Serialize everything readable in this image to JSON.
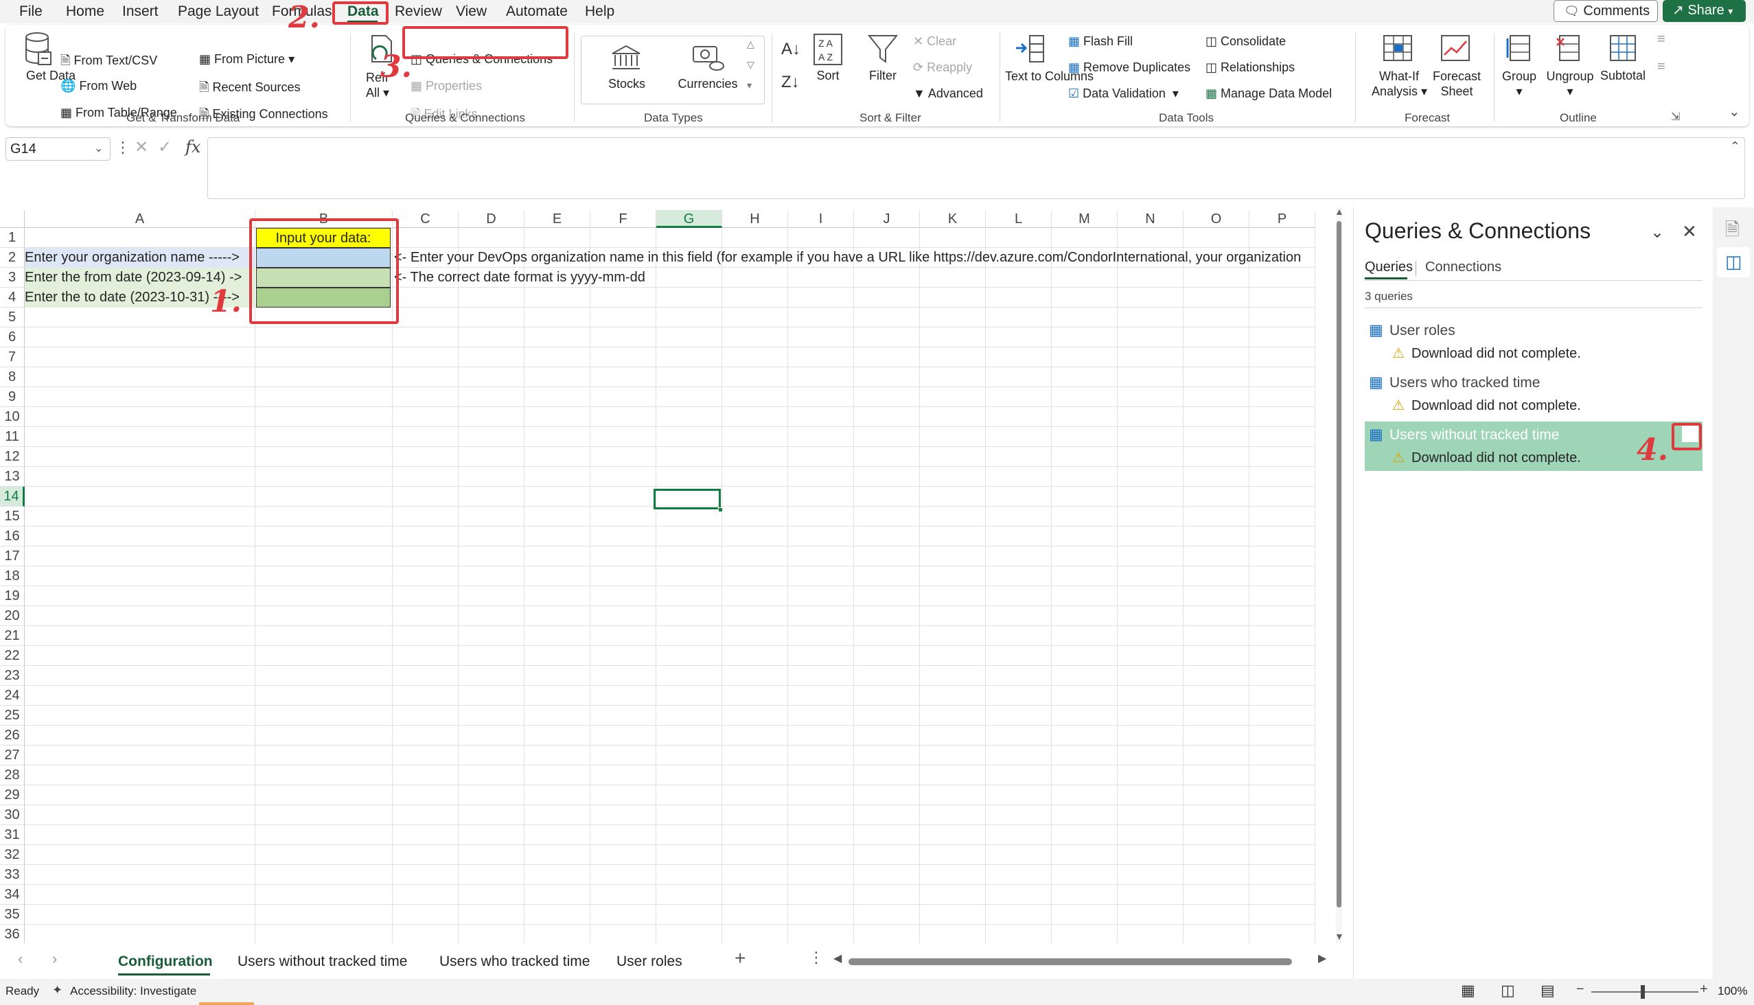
{
  "menu": {
    "tabs": [
      "File",
      "Home",
      "Insert",
      "Page Layout",
      "Formulas",
      "Data",
      "Review",
      "View",
      "Automate",
      "Help"
    ],
    "active": "Data",
    "comments_label": "Comments",
    "share_label": "Share"
  },
  "ribbon": {
    "get_transform": {
      "get_data": "Get Data",
      "from_text_csv": "From Text/CSV",
      "from_web": "From Web",
      "from_table_range": "From Table/Range",
      "from_picture": "From Picture",
      "recent_sources": "Recent Sources",
      "existing_connections": "Existing Connections",
      "label": "Get & Transform Data"
    },
    "queries": {
      "refresh_all": "Refresh All",
      "queries_connections": "Queries & Connections",
      "properties": "Properties",
      "edit_links": "Edit Links",
      "label": "Queries & Connections"
    },
    "data_types": {
      "stocks": "Stocks",
      "currencies": "Currencies",
      "label": "Data Types"
    },
    "sort_filter": {
      "sort": "Sort",
      "filter": "Filter",
      "clear": "Clear",
      "reapply": "Reapply",
      "advanced": "Advanced",
      "label": "Sort & Filter"
    },
    "data_tools": {
      "text_to_columns": "Text to Columns",
      "flash_fill": "Flash Fill",
      "remove_duplicates": "Remove Duplicates",
      "data_validation": "Data Validation",
      "consolidate": "Consolidate",
      "relationships": "Relationships",
      "manage_data_model": "Manage Data Model",
      "label": "Data Tools"
    },
    "forecast": {
      "what_if": "What-If Analysis",
      "forecast_sheet": "Forecast Sheet",
      "label": "Forecast"
    },
    "outline": {
      "group": "Group",
      "ungroup": "Ungroup",
      "subtotal": "Subtotal",
      "label": "Outline"
    }
  },
  "formula_bar": {
    "name_box": "G14",
    "fx": "fx"
  },
  "grid": {
    "columns": [
      "A",
      "B",
      "C",
      "D",
      "E",
      "F",
      "G",
      "H",
      "I",
      "J",
      "K",
      "L",
      "M",
      "N",
      "O",
      "P"
    ],
    "rows": [
      "1",
      "2",
      "3",
      "4",
      "5",
      "6",
      "7",
      "8",
      "9",
      "10",
      "11",
      "12",
      "13",
      "14",
      "15",
      "16",
      "17",
      "18",
      "19",
      "20",
      "21",
      "22",
      "23",
      "24",
      "25",
      "26",
      "27",
      "28",
      "29",
      "30",
      "31",
      "32",
      "33",
      "34",
      "35",
      "36"
    ],
    "b1": "Input your data:",
    "a2": "Enter your organization name ----->",
    "a3": "Enter the from date (2023-09-14) ->",
    "a4": "Enter the to date (2023-10-31) ---->",
    "c2": "<- Enter your DevOps organization name in this field (for example if you have a URL like https://dev.azure.com/CondorInternational, your organization",
    "c3": "<- The correct date format is yyyy-mm-dd",
    "colors": {
      "b1": "#ffff00",
      "b2": "#bdd7ee",
      "b3": "#c6e0b4",
      "b4": "#a9d08e",
      "a2": "#dde7f5",
      "a3": "#e2efda",
      "a4": "#e2efda"
    }
  },
  "sheets": {
    "tabs": [
      "Configuration",
      "Users without tracked time",
      "Users who tracked time",
      "User roles"
    ],
    "active": "Configuration"
  },
  "status": {
    "ready": "Ready",
    "accessibility": "Accessibility: Investigate",
    "zoom": "100%"
  },
  "pane": {
    "title": "Queries & Connections",
    "tab_queries": "Queries",
    "tab_connections": "Connections",
    "count": "3 queries",
    "items": [
      {
        "name": "User roles",
        "status": "Download did not complete."
      },
      {
        "name": "Users who tracked time",
        "status": "Download did not complete."
      },
      {
        "name": "Users without tracked time",
        "status": "Download did not complete."
      }
    ],
    "selected_color": "#9fd5b7"
  },
  "annotations": [
    "1.",
    "2.",
    "3.",
    "4."
  ]
}
